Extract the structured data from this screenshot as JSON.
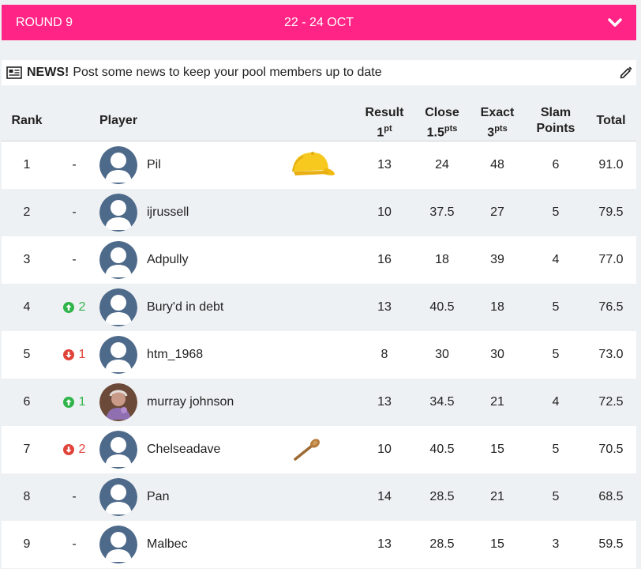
{
  "round": {
    "label": "ROUND 9",
    "dates": "22 - 24 OCT"
  },
  "news": {
    "heading": "NEWS!",
    "text": "Post some news to keep your pool members up to date"
  },
  "headers": {
    "rank": "Rank",
    "player": "Player",
    "result": "Result",
    "result_sub": "1",
    "result_sup": "pt",
    "close": "Close",
    "close_sub": "1.5",
    "close_sup": "pts",
    "exact": "Exact",
    "exact_sub": "3",
    "exact_sup": "pts",
    "slam1": "Slam",
    "slam2": "Points",
    "total": "Total"
  },
  "colors": {
    "accent": "#ff2485",
    "up": "#2fb44a",
    "down": "#e0433a"
  },
  "rows": [
    {
      "rank": "1",
      "move_dir": "none",
      "move": "-",
      "name": "Pil",
      "badge": "cap-icon",
      "result": "13",
      "close": "24",
      "exact": "48",
      "slam": "6",
      "total": "91.0"
    },
    {
      "rank": "2",
      "move_dir": "none",
      "move": "-",
      "name": "ijrussell",
      "badge": "",
      "result": "10",
      "close": "37.5",
      "exact": "27",
      "slam": "5",
      "total": "79.5"
    },
    {
      "rank": "3",
      "move_dir": "none",
      "move": "-",
      "name": "Adpully",
      "badge": "",
      "result": "16",
      "close": "18",
      "exact": "39",
      "slam": "4",
      "total": "77.0"
    },
    {
      "rank": "4",
      "move_dir": "up",
      "move": "2",
      "name": "Bury'd in debt",
      "badge": "",
      "result": "13",
      "close": "40.5",
      "exact": "18",
      "slam": "5",
      "total": "76.5"
    },
    {
      "rank": "5",
      "move_dir": "down",
      "move": "1",
      "name": "htm_1968",
      "badge": "",
      "result": "8",
      "close": "30",
      "exact": "30",
      "slam": "5",
      "total": "73.0"
    },
    {
      "rank": "6",
      "move_dir": "up",
      "move": "1",
      "name": "murray johnson",
      "badge": "",
      "photo": true,
      "result": "13",
      "close": "34.5",
      "exact": "21",
      "slam": "4",
      "total": "72.5"
    },
    {
      "rank": "7",
      "move_dir": "down",
      "move": "2",
      "name": "Chelseadave",
      "badge": "spoon-icon",
      "result": "10",
      "close": "40.5",
      "exact": "15",
      "slam": "5",
      "total": "70.5"
    },
    {
      "rank": "8",
      "move_dir": "none",
      "move": "-",
      "name": "Pan",
      "badge": "",
      "result": "14",
      "close": "28.5",
      "exact": "21",
      "slam": "5",
      "total": "68.5"
    },
    {
      "rank": "9",
      "move_dir": "none",
      "move": "-",
      "name": "Malbec",
      "badge": "",
      "result": "13",
      "close": "28.5",
      "exact": "15",
      "slam": "3",
      "total": "59.5"
    }
  ]
}
